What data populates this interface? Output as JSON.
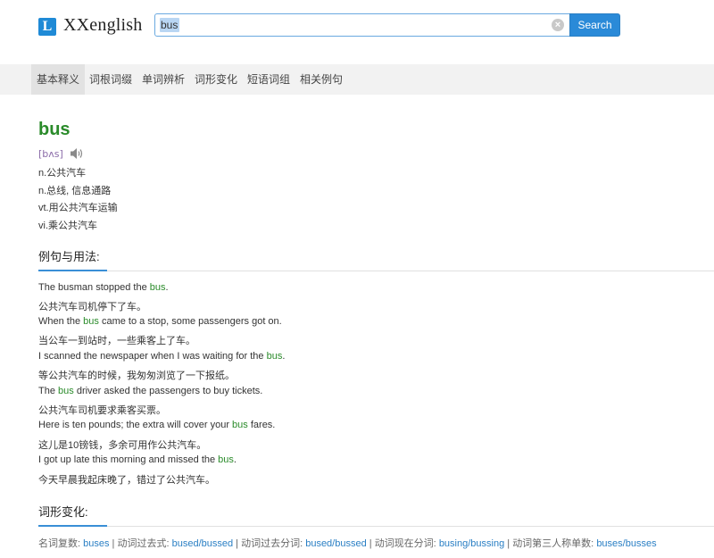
{
  "header": {
    "logo_letter": "L",
    "logo_text": "XXenglish",
    "search_value": "bus",
    "search_button": "Search",
    "clear_icon": "×"
  },
  "tabs": [
    {
      "label": "基本释义",
      "active": true
    },
    {
      "label": "词根词缀",
      "active": false
    },
    {
      "label": "单词辨析",
      "active": false
    },
    {
      "label": "词形变化",
      "active": false
    },
    {
      "label": "短语词组",
      "active": false
    },
    {
      "label": "相关例句",
      "active": false
    }
  ],
  "entry": {
    "word": "bus",
    "phonetic": "[bʌs]",
    "definitions": [
      "n.公共汽车",
      "n.总线, 信息通路",
      "vt.用公共汽车运输",
      "vi.乘公共汽车"
    ]
  },
  "examples": {
    "title": "例句与用法:",
    "items": [
      {
        "before": "The busman stopped the ",
        "hl": "bus",
        "after": "."
      },
      {
        "before": "公共汽车司机停下了车。",
        "hl": "",
        "after": ""
      },
      {
        "before": "When the ",
        "hl": "bus",
        "after": " came to a stop, some passengers got on."
      },
      {
        "before": "当公车一到站时，一些乘客上了车。",
        "hl": "",
        "after": ""
      },
      {
        "before": "I scanned the newspaper when I was waiting for the ",
        "hl": "bus",
        "after": "."
      },
      {
        "before": "等公共汽车的时候，我匆匆浏览了一下报纸。",
        "hl": "",
        "after": ""
      },
      {
        "before": "The ",
        "hl": "bus",
        "after": " driver asked the passengers to buy tickets."
      },
      {
        "before": "公共汽车司机要求乘客买票。",
        "hl": "",
        "after": ""
      },
      {
        "before": "Here is ten pounds; the extra will cover your ",
        "hl": "bus",
        "after": " fares."
      },
      {
        "before": "这儿是10镑钱，多余可用作公共汽车。",
        "hl": "",
        "after": ""
      },
      {
        "before": "I got up late this morning and missed the ",
        "hl": "bus",
        "after": "."
      },
      {
        "before": "今天早晨我起床晚了，错过了公共汽车。",
        "hl": "",
        "after": ""
      }
    ]
  },
  "inflections": {
    "title": "词形变化:",
    "items": [
      {
        "label": "名词复数: ",
        "value": "buses"
      },
      {
        "label": "动词过去式: ",
        "value": "bused/bussed"
      },
      {
        "label": "动词过去分词: ",
        "value": "bused/bussed"
      },
      {
        "label": "动词现在分词: ",
        "value": "busing/bussing"
      },
      {
        "label": "动词第三人称单数: ",
        "value": "buses/busses"
      }
    ],
    "separator": " | "
  },
  "colors": {
    "accent": "#2a8ad8",
    "word_green": "#2a8b2a",
    "phonetic_purple": "#8a6aa8"
  }
}
